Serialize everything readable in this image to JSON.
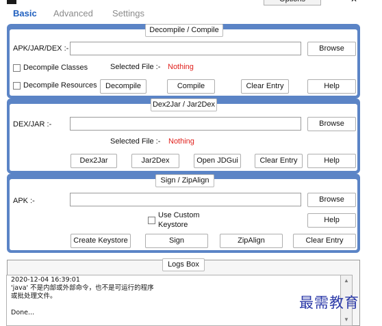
{
  "window": {
    "options_button": "Options",
    "minimize_glyph": "—",
    "close_glyph": "✕"
  },
  "tabs": [
    {
      "label": "Basic",
      "active": true
    },
    {
      "label": "Advanced",
      "active": false
    },
    {
      "label": "Settings",
      "active": false
    }
  ],
  "decompile": {
    "title": "Decompile / Compile",
    "input_label": "APK/JAR/DEX :-",
    "input_value": "",
    "browse": "Browse",
    "decompile_classes": "Decompile Classes",
    "decompile_resources": "Decompile Resources",
    "selected_file_label": "Selected File :-",
    "selected_file_value": "Nothing",
    "decompile_button": "Decompile",
    "compile_button": "Compile",
    "clear_entry": "Clear Entry",
    "help": "Help"
  },
  "dex2jar": {
    "title": "Dex2Jar / Jar2Dex",
    "input_label": "DEX/JAR :-",
    "input_value": "",
    "browse": "Browse",
    "selected_file_label": "Selected File :-",
    "selected_file_value": "Nothing",
    "dex2jar_button": "Dex2Jar",
    "jar2dex_button": "Jar2Dex",
    "open_jdgui_button": "Open JDGui",
    "clear_entry": "Clear Entry",
    "help": "Help"
  },
  "sign": {
    "title": "Sign / ZipAlign",
    "input_label": "APK :-",
    "input_value": "",
    "browse": "Browse",
    "use_custom_keystore_line1": "Use Custom",
    "use_custom_keystore_line2": "Keystore",
    "help": "Help",
    "create_keystore": "Create Keystore",
    "sign_button": "Sign",
    "zipalign_button": "ZipAlign",
    "clear_entry": "Clear Entry"
  },
  "logs": {
    "title": "Logs Box",
    "lines": [
      "2020-12-04 16:39:01",
      "'java' 不是内部或外部命令，也不是可运行的程序",
      "或批处理文件。",
      "",
      "Done..."
    ]
  },
  "watermark": "最需教育",
  "colors": {
    "group_border": "#5b84c6",
    "active_tab": "#1f5fbf",
    "nothing_text": "#e0201c",
    "watermark": "#2c3aa8"
  }
}
